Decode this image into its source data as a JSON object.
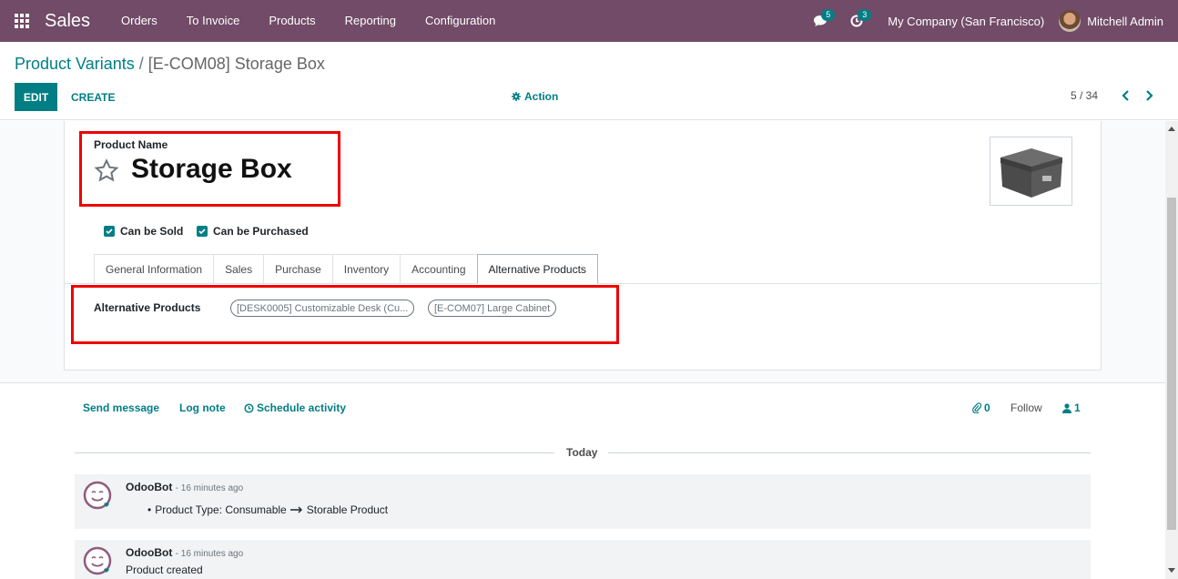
{
  "navbar": {
    "app_name": "Sales",
    "menu": [
      "Orders",
      "To Invoice",
      "Products",
      "Reporting",
      "Configuration"
    ],
    "messages_count": "5",
    "activities_count": "3",
    "company": "My Company (San Francisco)",
    "user": "Mitchell Admin"
  },
  "control_panel": {
    "breadcrumb_parent": "Product Variants",
    "breadcrumb_sep": "/",
    "breadcrumb_current": "[E-COM08] Storage Box",
    "edit_label": "EDIT",
    "create_label": "CREATE",
    "action_label": "Action",
    "pager": "5 / 34"
  },
  "form": {
    "name_label": "Product Name",
    "name": "Storage Box",
    "can_be_sold": "Can be Sold",
    "can_be_purchased": "Can be Purchased",
    "tabs": [
      "General Information",
      "Sales",
      "Purchase",
      "Inventory",
      "Accounting",
      "Alternative Products"
    ],
    "active_tab": "Alternative Products",
    "alt_products_label": "Alternative Products",
    "alt_products": [
      "[DESK0005] Customizable Desk (Cu...",
      "[E-COM07] Large Cabinet"
    ]
  },
  "chatter": {
    "send_message": "Send message",
    "log_note": "Log note",
    "schedule_activity": "Schedule activity",
    "attachments": "0",
    "follow": "Follow",
    "followers": "1",
    "date_separator": "Today",
    "messages": [
      {
        "author": "OdooBot",
        "time": "- 16 minutes ago",
        "field": "Product Type: Consumable",
        "new_value": "Storable Product"
      },
      {
        "author": "OdooBot",
        "time": "- 16 minutes ago",
        "body": "Product created"
      }
    ]
  },
  "colors": {
    "navbar": "#714B67",
    "accent": "#017e84",
    "highlight": "#e00000"
  }
}
